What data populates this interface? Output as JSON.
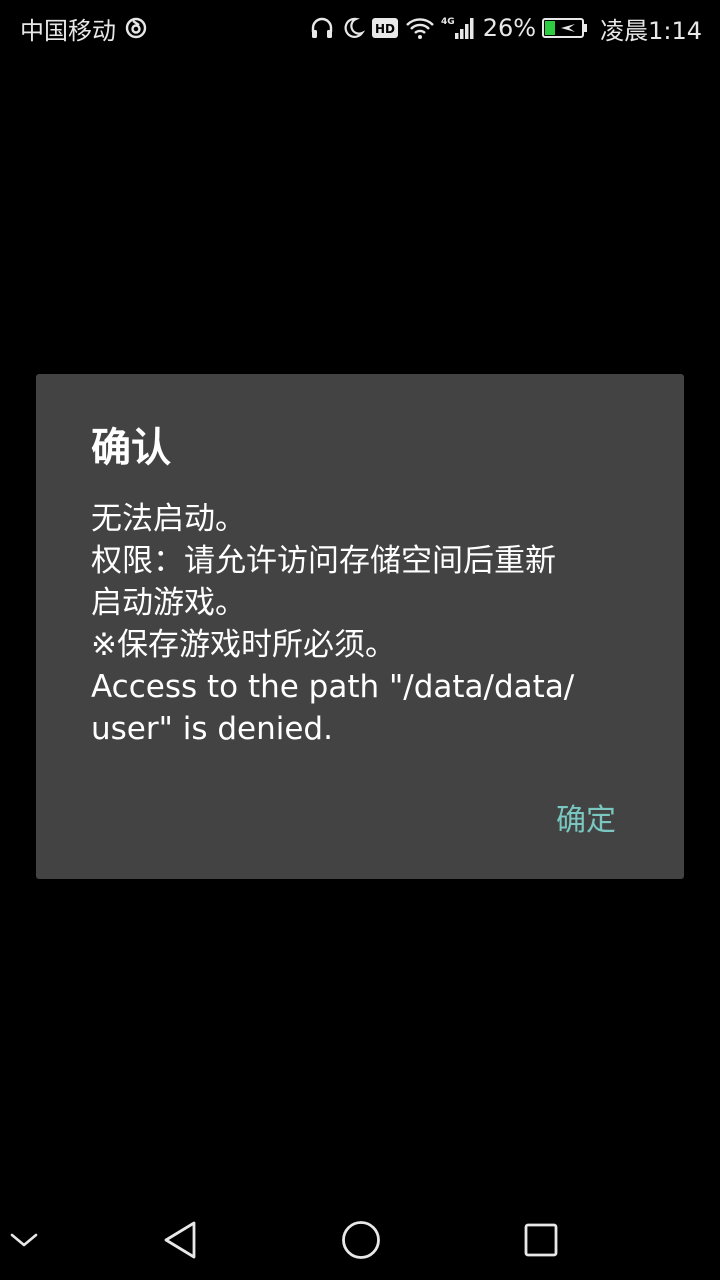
{
  "status_bar": {
    "carrier": "中国移动",
    "network_type": "4G",
    "battery_percent": "26%",
    "time": "凌晨1:14",
    "icons": [
      "sync-icon",
      "headphones-icon",
      "moon-icon",
      "hd-icon",
      "wifi-icon",
      "signal-icon",
      "battery-icon"
    ]
  },
  "dialog": {
    "title": "确认",
    "message_lines": [
      "无法启动。",
      "权限：请允许访问存储空间后重新",
      "启动游戏。",
      "※保存游戏时所必须。",
      "Access to the path \"/data/data/",
      "user\" is denied."
    ],
    "confirm_label": "确定",
    "colors": {
      "background": "#434343",
      "accent": "#79c7c0"
    }
  },
  "nav_bar": {
    "icons": [
      "chevron-down-icon",
      "back-icon",
      "home-icon",
      "recents-icon"
    ]
  }
}
